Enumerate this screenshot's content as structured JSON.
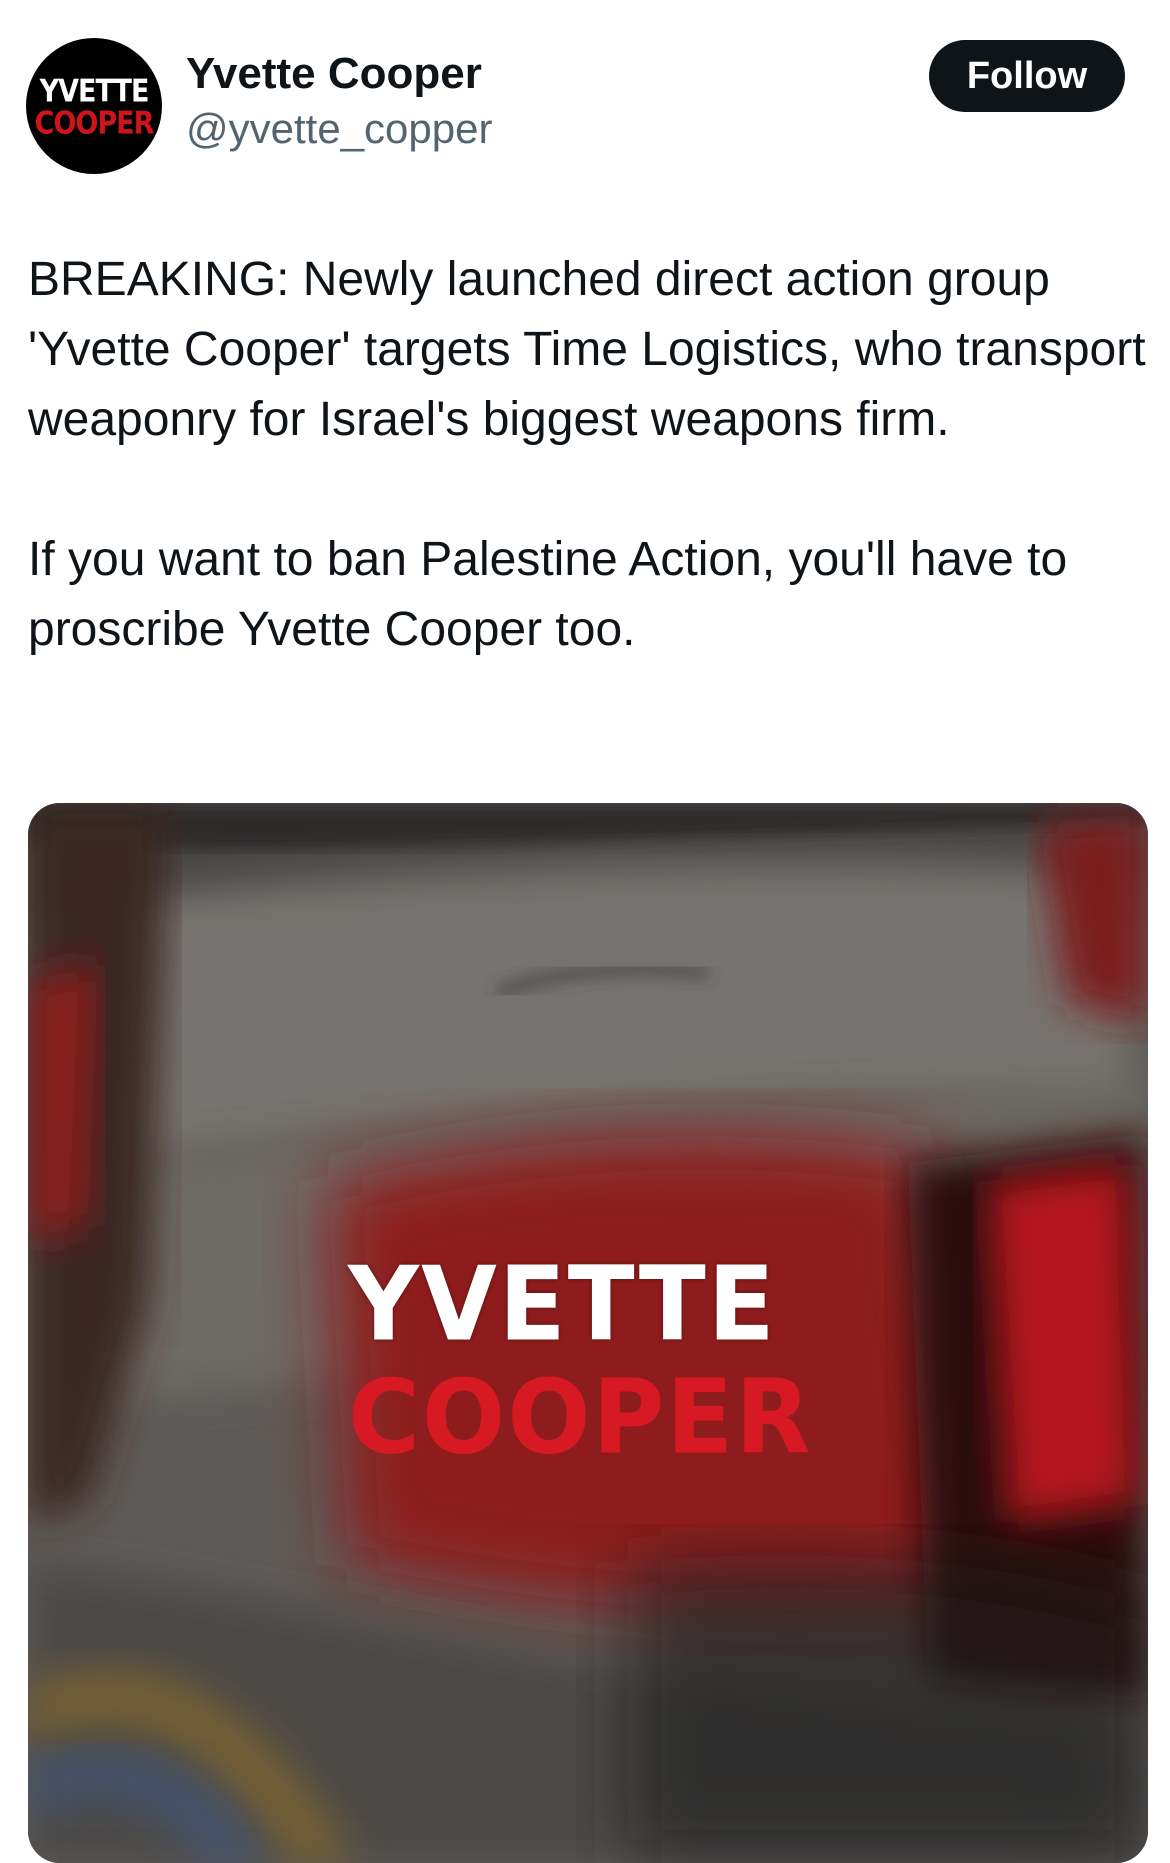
{
  "header": {
    "avatar": {
      "line1": "YVETTE",
      "line2": "COOPER"
    },
    "display_name": "Yvette Cooper",
    "handle": "@yvette_copper",
    "follow_label": "Follow"
  },
  "tweet": {
    "paragraphs": [
      "BREAKING: Newly launched direct action group 'Yvette Cooper' targets Time Logistics, who transport weaponry for Israel's biggest weapons firm.",
      "If you want to ban Palestine Action, you'll have to proscribe Yvette Cooper too."
    ]
  },
  "media": {
    "line1": "YVETTE",
    "line2": "COOPER"
  },
  "colors": {
    "follow_bg": "#0f1419",
    "handle": "#536471",
    "brand_red": "#d61922"
  }
}
